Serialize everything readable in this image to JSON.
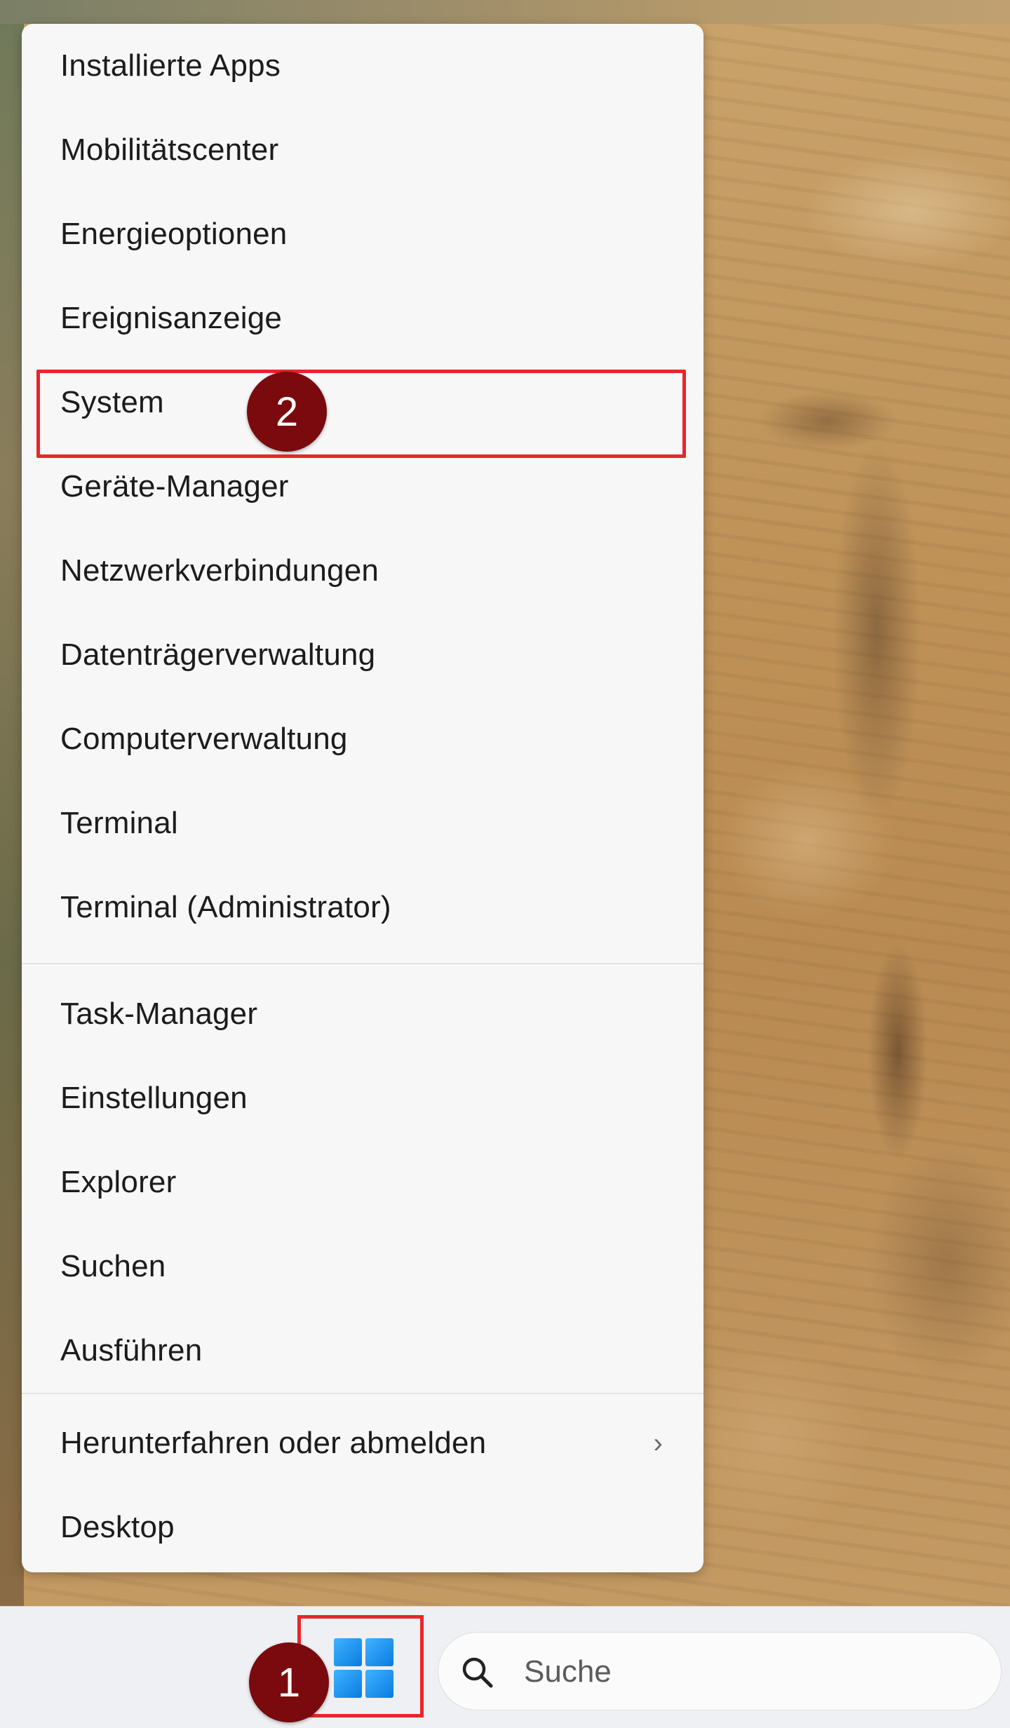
{
  "menu": {
    "groups": [
      {
        "items": [
          {
            "label": "Installierte Apps"
          },
          {
            "label": "Mobilitätscenter"
          },
          {
            "label": "Energieoptionen"
          },
          {
            "label": "Ereignisanzeige"
          },
          {
            "label": "System"
          },
          {
            "label": "Geräte-Manager"
          },
          {
            "label": "Netzwerkverbindungen"
          },
          {
            "label": "Datenträgerverwaltung"
          },
          {
            "label": "Computerverwaltung"
          },
          {
            "label": "Terminal"
          },
          {
            "label": "Terminal (Administrator)"
          }
        ]
      },
      {
        "items": [
          {
            "label": "Task-Manager"
          },
          {
            "label": "Einstellungen"
          },
          {
            "label": "Explorer"
          },
          {
            "label": "Suchen"
          },
          {
            "label": "Ausführen"
          }
        ]
      },
      {
        "items": [
          {
            "label": "Herunterfahren oder abmelden",
            "submenu_indicator": "›"
          },
          {
            "label": "Desktop"
          }
        ]
      }
    ]
  },
  "annotations": {
    "step_1": "1",
    "step_2": "2",
    "highlight_color": "#e8262b",
    "badge_color": "#7a0a0d"
  },
  "taskbar": {
    "start_icon": "windows-logo-icon",
    "search": {
      "icon": "search-icon",
      "placeholder": "Suche"
    }
  }
}
